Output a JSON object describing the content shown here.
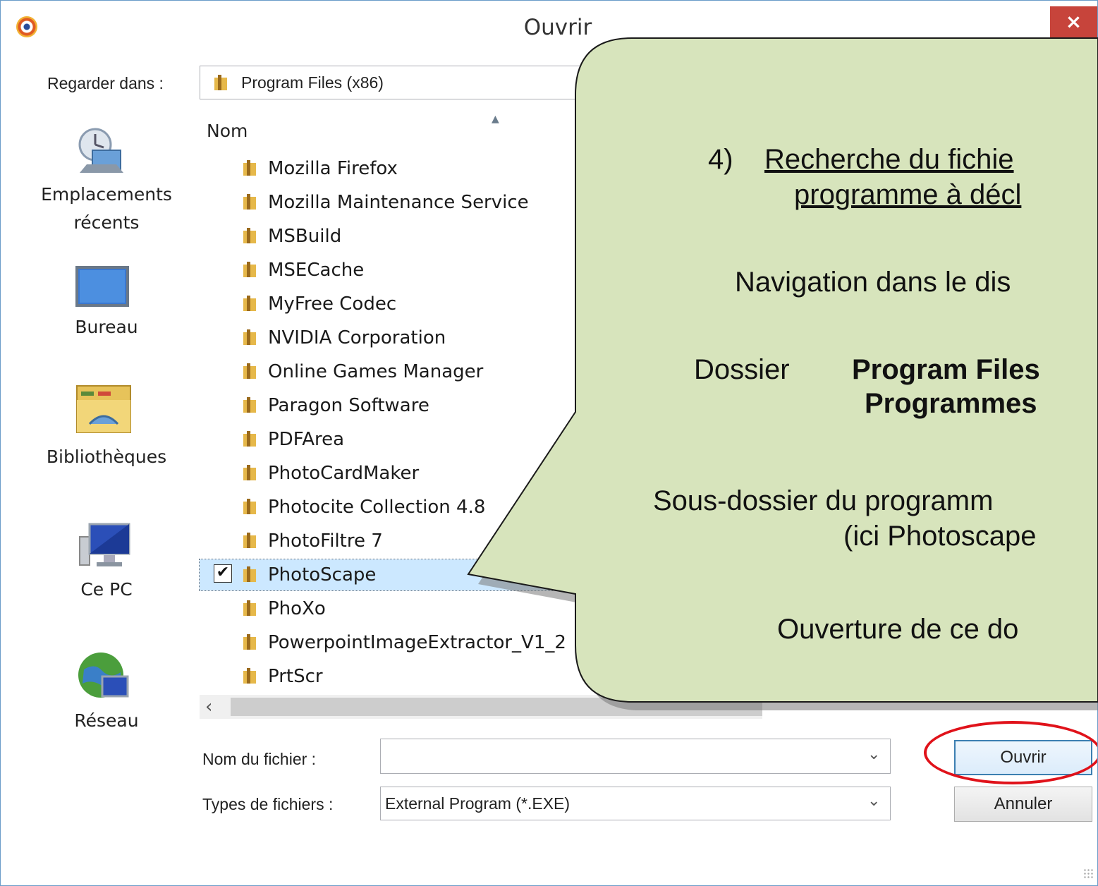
{
  "window": {
    "title": "Ouvrir",
    "close_label": "×"
  },
  "lookin": {
    "label": "Regarder dans :",
    "value": "Program Files (x86)"
  },
  "places": [
    {
      "label_1": "Emplacements",
      "label_2": "récents",
      "icon": "recent-places-icon"
    },
    {
      "label": "Bureau",
      "icon": "desktop-icon"
    },
    {
      "label": "Bibliothèques",
      "icon": "libraries-icon"
    },
    {
      "label": "Ce PC",
      "icon": "computer-icon"
    },
    {
      "label": "Réseau",
      "icon": "network-icon"
    }
  ],
  "list": {
    "column_header": "Nom",
    "items": [
      "Mozilla Firefox",
      "Mozilla Maintenance Service",
      "MSBuild",
      "MSECache",
      "MyFree Codec",
      "NVIDIA Corporation",
      "Online Games Manager",
      "Paragon Software",
      "PDFArea",
      "PhotoCardMaker",
      "Photocite Collection 4.8",
      "PhotoFiltre 7",
      "PhotoScape",
      "PhoXo",
      "PowerpointImageExtractor_V1_2",
      "PrtScr"
    ],
    "selected": "PhotoScape"
  },
  "filename": {
    "label": "Nom du fichier :",
    "value": ""
  },
  "filetype": {
    "label": "Types de fichiers :",
    "value": "External Program (*.EXE)"
  },
  "buttons": {
    "open": "Ouvrir",
    "cancel": "Annuler"
  },
  "callout": {
    "line1_num": "4)",
    "line1": "Recherche du fichie",
    "line2": "programme à décl",
    "line3": "Navigation dans le dis",
    "line4_prefix": "Dossier",
    "line4_bold": "Program Files",
    "line5": "Programmes",
    "line6": "Sous-dossier du programm",
    "line7": "(ici Photoscape",
    "line8": "Ouverture de ce do"
  },
  "colors": {
    "callout_fill": "#d7e4bc",
    "callout_border": "#1a1a1a",
    "highlight_ellipse": "#e0121a",
    "close_button": "#c7443b"
  }
}
